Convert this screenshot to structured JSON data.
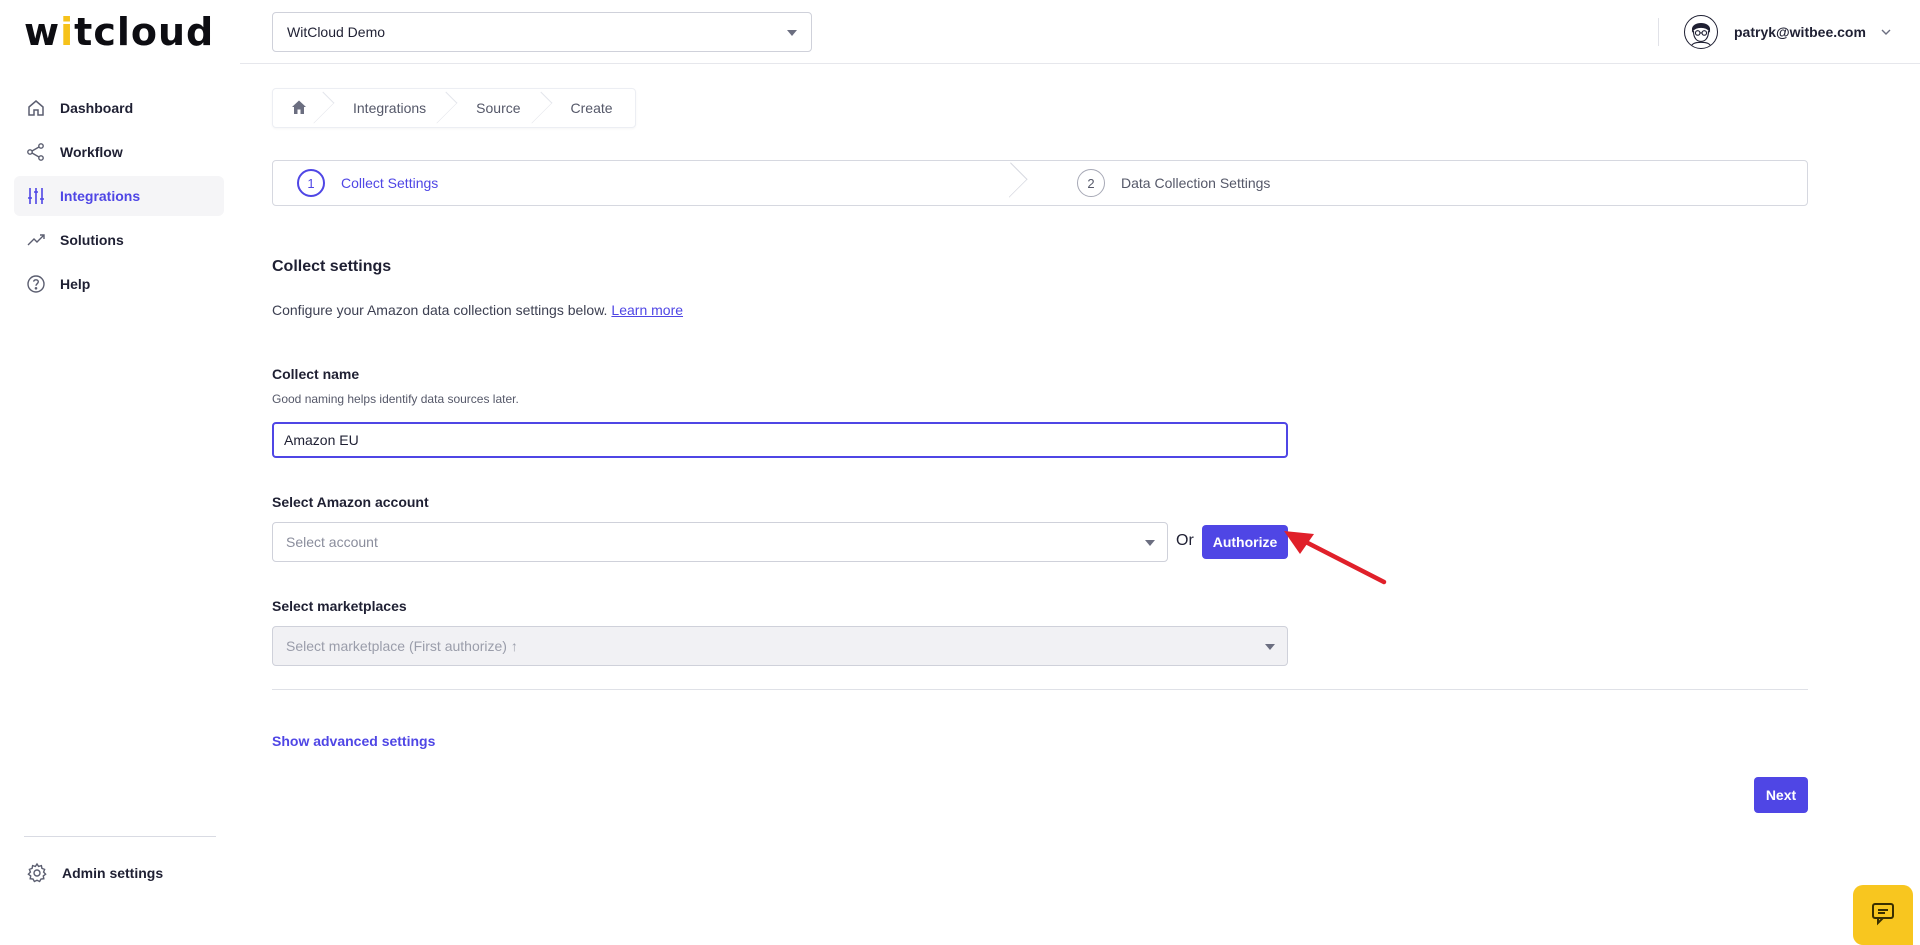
{
  "app": {
    "logo_prefix": "w",
    "logo_accent": "i",
    "logo_middle": "t",
    "logo_suffix": "cloud",
    "accent_color": "#4f46e5",
    "brand_yellow": "#f6c21b"
  },
  "sidebar": {
    "items": [
      {
        "label": "Dashboard",
        "icon": "home-icon",
        "active": false
      },
      {
        "label": "Workflow",
        "icon": "share-nodes-icon",
        "active": false
      },
      {
        "label": "Integrations",
        "icon": "sliders-icon",
        "active": true
      },
      {
        "label": "Solutions",
        "icon": "trending-up-icon",
        "active": false
      },
      {
        "label": "Help",
        "icon": "help-circle-icon",
        "active": false
      }
    ],
    "admin_label": "Admin settings"
  },
  "topbar": {
    "org_selected": "WitCloud Demo",
    "user_email": "patryk@witbee.com"
  },
  "breadcrumb": {
    "items": [
      "Integrations",
      "Source",
      "Create"
    ]
  },
  "stepper": {
    "steps": [
      {
        "number": "1",
        "label": "Collect Settings",
        "active": true
      },
      {
        "number": "2",
        "label": "Data Collection Settings",
        "active": false
      }
    ]
  },
  "form": {
    "title": "Collect settings",
    "description": "Configure your Amazon data collection settings below.",
    "learn_more": "Learn more",
    "collect_name": {
      "label": "Collect name",
      "help": "Good naming helps identify data sources later.",
      "value": "Amazon EU"
    },
    "account": {
      "label": "Select Amazon account",
      "placeholder": "Select account",
      "or_text": "Or",
      "authorize_label": "Authorize"
    },
    "marketplaces": {
      "label": "Select marketplaces",
      "placeholder": "Select marketplace (First authorize) ↑"
    },
    "advanced_link": "Show advanced settings",
    "next_label": "Next"
  }
}
